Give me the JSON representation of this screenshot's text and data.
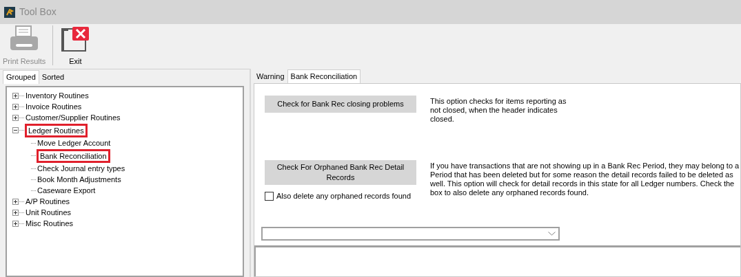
{
  "window": {
    "title": "Tool Box"
  },
  "toolbar": [
    {
      "label": "Print Results",
      "disabled": true,
      "kind": "print"
    },
    {
      "label": "Exit",
      "disabled": false,
      "kind": "exit"
    }
  ],
  "left_tabs": [
    {
      "label": "Grouped",
      "selected": true
    },
    {
      "label": "Sorted",
      "selected": false
    }
  ],
  "tree": [
    {
      "label": "Inventory Routines",
      "expanded": false,
      "highlighted": false
    },
    {
      "label": "Invoice Routines",
      "expanded": false,
      "highlighted": false
    },
    {
      "label": "Customer/Supplier Routines",
      "expanded": false,
      "highlighted": false
    },
    {
      "label": "Ledger Routines",
      "expanded": true,
      "highlighted": true,
      "children": [
        {
          "label": "Move Ledger Account",
          "highlighted": false
        },
        {
          "label": "Bank Reconciliation",
          "highlighted": true
        },
        {
          "label": "Check Journal entry types",
          "highlighted": false
        },
        {
          "label": "Book Month Adjustments",
          "highlighted": false
        },
        {
          "label": "Caseware Export",
          "highlighted": false
        }
      ]
    },
    {
      "label": "A/P Routines",
      "expanded": false,
      "highlighted": false
    },
    {
      "label": "Unit Routines",
      "expanded": false,
      "highlighted": false
    },
    {
      "label": "Misc Routines",
      "expanded": false,
      "highlighted": false
    }
  ],
  "right_tabs": [
    {
      "label": "Warning",
      "selected": false
    },
    {
      "label": "Bank Reconciliation",
      "selected": true
    }
  ],
  "options": [
    {
      "button": "Check for Bank Rec closing problems",
      "description": "This option checks for items reporting as not closed, when the header indicates closed."
    },
    {
      "button": "Check For Orphaned Bank Rec Detail Records",
      "description": "If you have transactions that are not showing up in a Bank Rec Period, they may belong to a Period that has been deleted but for some reason the detail records failed to be deleted as well.  This option will check for detail records in this state for all Ledger numbers.  Check the box to also delete any orphaned records found.",
      "checkbox": {
        "label": "Also delete any orphaned records found",
        "checked": false
      }
    }
  ]
}
